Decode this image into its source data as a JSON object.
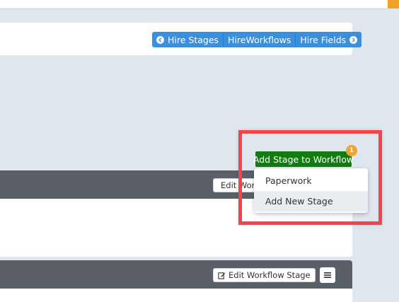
{
  "colors": {
    "nav_blue": "#3a8fde",
    "add_green": "#137b12",
    "badge_orange": "#f2a233",
    "panel_header": "#5b6068",
    "highlight_red": "#f3434c"
  },
  "nav": {
    "prev_label": "Hire Stages",
    "current_label": "HireWorkflows",
    "next_label": "Hire Fields",
    "prev_icon": "chevron-left-circle-icon",
    "next_icon": "chevron-right-circle-icon"
  },
  "add_stage": {
    "label": "Add Stage to Workflow",
    "badge": "1"
  },
  "dropdown": {
    "items": [
      {
        "label": "Paperwork"
      },
      {
        "label": "Add New Stage"
      }
    ]
  },
  "panels": [
    {
      "edit_label": "Edit Workflow Stage"
    },
    {
      "edit_label": "Edit Workflow Stage"
    }
  ]
}
